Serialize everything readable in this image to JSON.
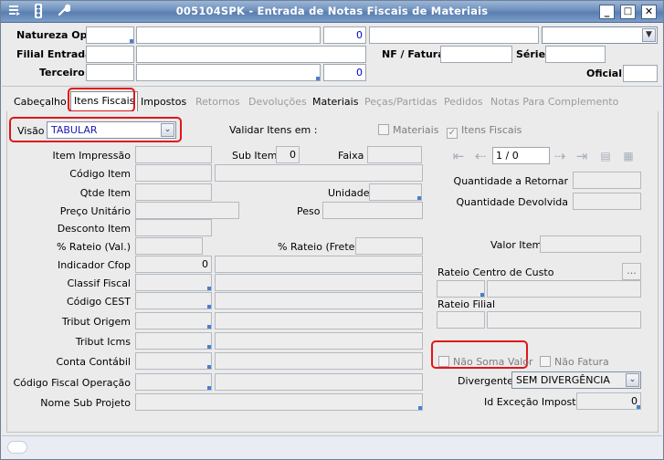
{
  "window": {
    "title": "005104SPK - Entrada de Notas Fiscais de Materiais",
    "icons": [
      "menu-icon",
      "traffic-light-icon",
      "wrench-icon"
    ],
    "minimize": "_",
    "maximize": "□",
    "close": "✕"
  },
  "header": {
    "natureza_label": "Natureza Op.",
    "natureza_num": "0",
    "filial_label": "Filial Entrada",
    "nf_label": "NF / Fatura",
    "serie_label": "Série",
    "terceiro_label": "Terceiro",
    "terceiro_num": "0",
    "oficial_label": "Oficial"
  },
  "tabs": [
    {
      "label": "Cabeçalho",
      "state": "normal"
    },
    {
      "label": "Itens Fiscais",
      "state": "selected"
    },
    {
      "label": "Impostos",
      "state": "normal"
    },
    {
      "label": "Retornos",
      "state": "disabled"
    },
    {
      "label": "Devoluções",
      "state": "disabled"
    },
    {
      "label": "Materiais",
      "state": "normal"
    },
    {
      "label": "Peças/Partidas",
      "state": "disabled"
    },
    {
      "label": "Pedidos",
      "state": "disabled"
    },
    {
      "label": "Notas Para Complemento",
      "state": "disabled"
    }
  ],
  "itens": {
    "visao_label": "Visão",
    "visao_value": "TABULAR",
    "validar_label": "Validar Itens em :",
    "chk_materiais": "Materiais",
    "chk_itens_fiscais": "Itens Fiscais",
    "item_impressao": "Item Impressão",
    "sub_item": "Sub Item",
    "sub_item_value": "0",
    "faixa": "Faixa",
    "codigo_item": "Código Item",
    "qtde_item": "Qtde Item",
    "unidade": "Unidade",
    "preco_unitario": "Preço Unitário",
    "peso": "Peso",
    "desconto_item": "Desconto Item",
    "rateio_val": "% Rateio (Val.)",
    "rateio_frete": "% Rateio (Frete)",
    "indicador_cfop": "Indicador Cfop",
    "indicador_cfop_value": "0",
    "classif_fiscal": "Classif Fiscal",
    "codigo_cest": "Código CEST",
    "tribut_origem": "Tribut Origem",
    "tribut_icms": "Tribut Icms",
    "conta_contabil": "Conta Contábil",
    "codigo_fiscal_operacao": "Código Fiscal Operação",
    "nome_sub_projeto": "Nome Sub Projeto",
    "pager": "1 / 0",
    "qtd_retornar": "Quantidade a Retornar",
    "qtd_devolvida": "Quantidade Devolvida",
    "valor_item": "Valor Item",
    "rateio_centro": "Rateio Centro de Custo",
    "rateio_centro_btn": "...",
    "rateio_filial": "Rateio Filial",
    "nao_soma_valor": "Não Soma Valor",
    "nao_fatura": "Não Fatura",
    "divergente_label": "Divergente",
    "divergente_value": "SEM DIVERGÊNCIA",
    "id_excecao": "Id Exceção Imposto",
    "id_excecao_value": "0"
  },
  "colors": {
    "highlight": "#e0151a",
    "title_bg": "#6e8fbc"
  }
}
